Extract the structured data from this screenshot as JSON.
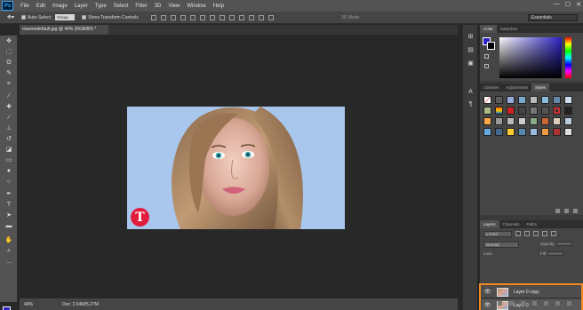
{
  "app": {
    "logo": "Ps"
  },
  "menu": [
    "File",
    "Edit",
    "Image",
    "Layer",
    "Type",
    "Select",
    "Filter",
    "3D",
    "View",
    "Window",
    "Help"
  ],
  "window_controls": [
    "—",
    "☐",
    "✕"
  ],
  "options": {
    "auto_select_label": "Auto-Select:",
    "auto_select_value": "Group",
    "transform_label": "Show Transform Controls",
    "mode_3d_label": "3D Mode:",
    "workspace": "Essentials"
  },
  "document": {
    "tab_title": "maxresdefault.jpg @ 40% (RGB/8#) *",
    "watermark_letter": "T"
  },
  "status": {
    "zoom": "40%",
    "doc": "Doc: 2.64M/5.27M"
  },
  "panels": {
    "color_tabs": [
      "Color",
      "Swatches"
    ],
    "style_tabs": [
      "Libraries",
      "Adjustments",
      "Styles"
    ],
    "layer_tabs": [
      "Layers",
      "Channels",
      "Paths"
    ],
    "colors": {
      "foreground": "#2c22c2",
      "background": "#000000",
      "highlight": "#f28a24"
    }
  },
  "layers": {
    "kind": "ρ Kind",
    "blend_mode": "Normal",
    "opacity_label": "Opacity:",
    "lock_label": "Lock:",
    "fill_label": "Fill:",
    "items": [
      {
        "name": "Layer 0 copy",
        "visible": "👁"
      },
      {
        "name": "Layer 0",
        "visible": "👁"
      }
    ]
  }
}
